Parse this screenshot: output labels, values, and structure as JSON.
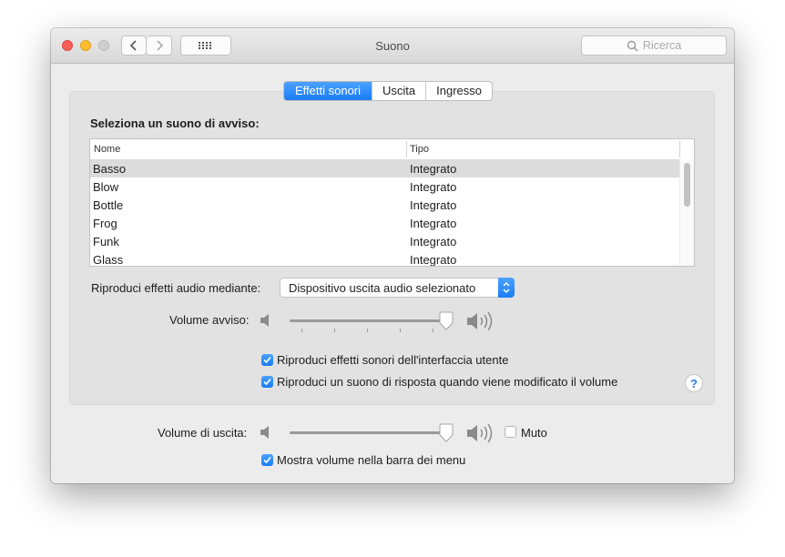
{
  "window": {
    "title": "Suono"
  },
  "search": {
    "placeholder": "Ricerca"
  },
  "tabs": [
    {
      "label": "Effetti sonori",
      "active": true
    },
    {
      "label": "Uscita",
      "active": false
    },
    {
      "label": "Ingresso",
      "active": false
    }
  ],
  "alert_section": {
    "label": "Seleziona un suono di avviso:"
  },
  "sound_list": {
    "columns": [
      "Nome",
      "Tipo"
    ],
    "rows": [
      {
        "name": "Basso",
        "type": "Integrato",
        "selected": true
      },
      {
        "name": "Blow",
        "type": "Integrato",
        "selected": false
      },
      {
        "name": "Bottle",
        "type": "Integrato",
        "selected": false
      },
      {
        "name": "Frog",
        "type": "Integrato",
        "selected": false
      },
      {
        "name": "Funk",
        "type": "Integrato",
        "selected": false
      },
      {
        "name": "Glass",
        "type": "Integrato",
        "selected": false
      }
    ]
  },
  "play_through": {
    "label": "Riproduci effetti audio mediante:",
    "value": "Dispositivo uscita audio selezionato"
  },
  "alert_volume": {
    "label": "Volume avviso:",
    "level": 0.98
  },
  "checkboxes": [
    {
      "label": "Riproduci effetti sonori dell'interfaccia utente",
      "checked": true
    },
    {
      "label": "Riproduci un suono di risposta quando viene modificato il volume",
      "checked": true
    }
  ],
  "help": {
    "label": "?"
  },
  "output_volume": {
    "label": "Volume di uscita:",
    "level": 0.98
  },
  "mute": {
    "label": "Muto",
    "checked": false
  },
  "show_volume": {
    "label": "Mostra volume nella barra dei menu",
    "checked": true
  },
  "colors": {
    "accent": "#1b7cf5",
    "selection": "#dcdcdc"
  },
  "icons": [
    "back-icon",
    "forward-icon",
    "grid-icon",
    "search-icon",
    "speaker-low-icon",
    "speaker-high-icon",
    "help-icon",
    "checkmark-icon"
  ]
}
